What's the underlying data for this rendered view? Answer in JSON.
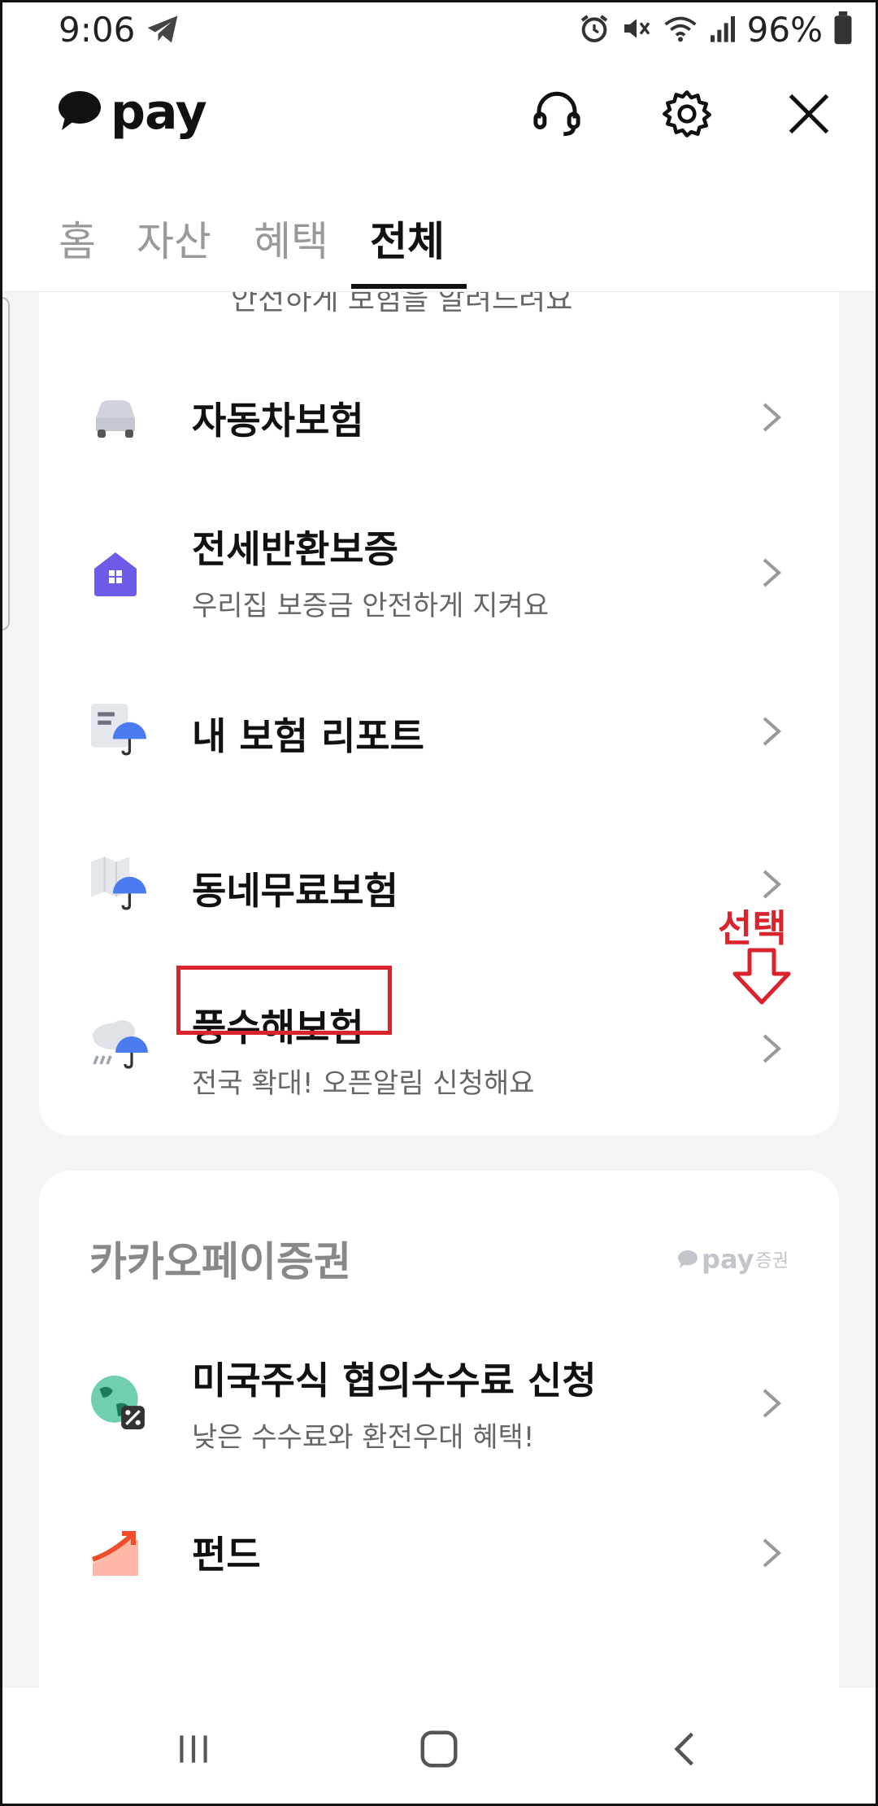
{
  "status": {
    "time": "9:06",
    "battery": "96%"
  },
  "appbar": {
    "logo_text": "pay",
    "icons": [
      "headset-icon",
      "gear-icon",
      "close-icon"
    ]
  },
  "tabs": [
    {
      "label": "홈",
      "active": false
    },
    {
      "label": "자산",
      "active": false
    },
    {
      "label": "혜택",
      "active": false
    },
    {
      "label": "전체",
      "active": true
    }
  ],
  "insurance": {
    "clipped_text": "안전하게 보험을 알려드려요",
    "items": [
      {
        "title": "자동차보험",
        "subtitle": "",
        "icon": "car-icon"
      },
      {
        "title": "전세반환보증",
        "subtitle": "우리집 보증금 안전하게 지켜요",
        "icon": "house-icon"
      },
      {
        "title": "내 보험 리포트",
        "subtitle": "",
        "icon": "report-umbrella-icon"
      },
      {
        "title": "동네무료보험",
        "subtitle": "",
        "icon": "map-umbrella-icon"
      },
      {
        "title": "풍수해보험",
        "subtitle": "전국 확대! 오픈알림 신청해요",
        "icon": "rain-umbrella-icon"
      }
    ]
  },
  "securities": {
    "title": "카카오페이증권",
    "brand_pay": "pay",
    "brand_suffix": "증권",
    "items": [
      {
        "title": "미국주식 협의수수료 신청",
        "subtitle": "낮은 수수료와 환전우대 혜택!",
        "icon": "globe-percent-icon"
      },
      {
        "title": "펀드",
        "subtitle": "",
        "icon": "fund-chart-icon"
      }
    ]
  },
  "annotation": {
    "label": "선택"
  },
  "colors": {
    "accent_red": "#d9232d",
    "house_purple": "#6c5ce7",
    "umbrella_blue": "#4a7cf0"
  }
}
